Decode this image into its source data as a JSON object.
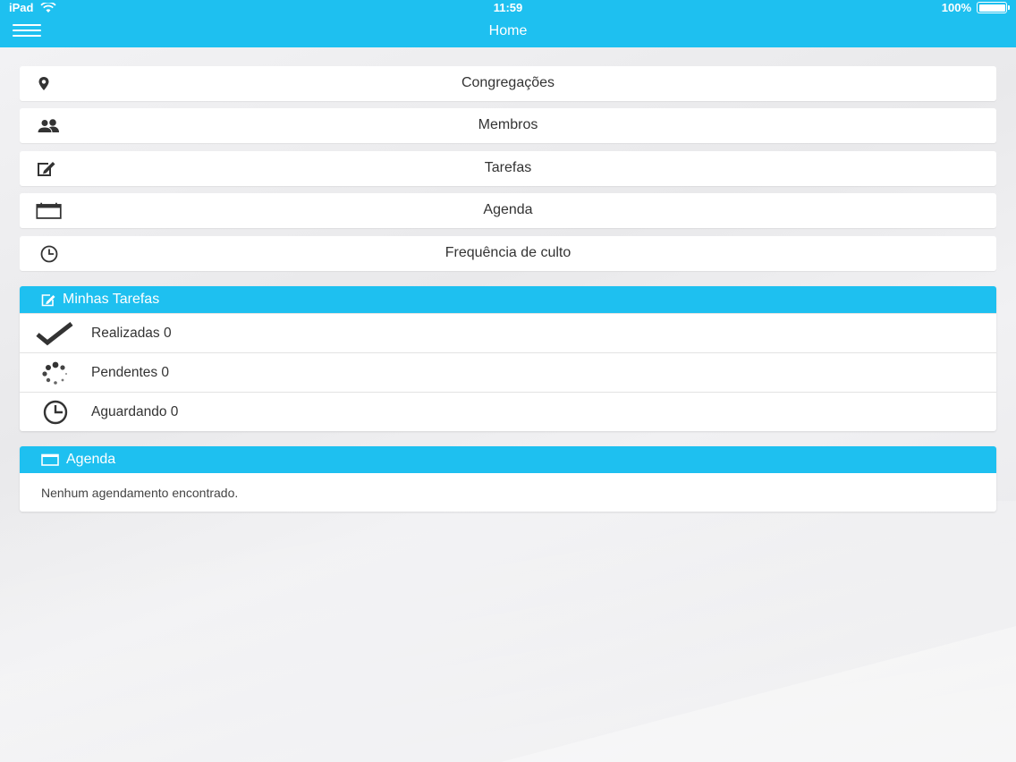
{
  "status_bar": {
    "device": "iPad",
    "time": "11:59",
    "battery": "100%",
    "battery_level": 1.0
  },
  "navbar": {
    "title": "Home"
  },
  "menu": [
    {
      "label": "Congregações",
      "icon": "location-pin-icon"
    },
    {
      "label": "Membros",
      "icon": "users-icon"
    },
    {
      "label": "Tarefas",
      "icon": "edit-icon"
    },
    {
      "label": "Agenda",
      "icon": "calendar-icon"
    },
    {
      "label": "Frequência de culto",
      "icon": "clock-icon"
    }
  ],
  "minhas_tarefas": {
    "title": "Minhas Tarefas",
    "icon": "edit-icon",
    "items": [
      {
        "label": "Realizadas 0",
        "icon": "checkmark-icon"
      },
      {
        "label": "Pendentes 0",
        "icon": "spinner-icon"
      },
      {
        "label": "Aguardando 0",
        "icon": "clock-icon"
      }
    ]
  },
  "agenda_panel": {
    "title": "Agenda",
    "icon": "calendar-icon",
    "empty_text": "Nenhum agendamento encontrado."
  },
  "colors": {
    "accent": "#1ec0f0",
    "card": "#ffffff",
    "text": "#333333",
    "background": "#ececee"
  }
}
